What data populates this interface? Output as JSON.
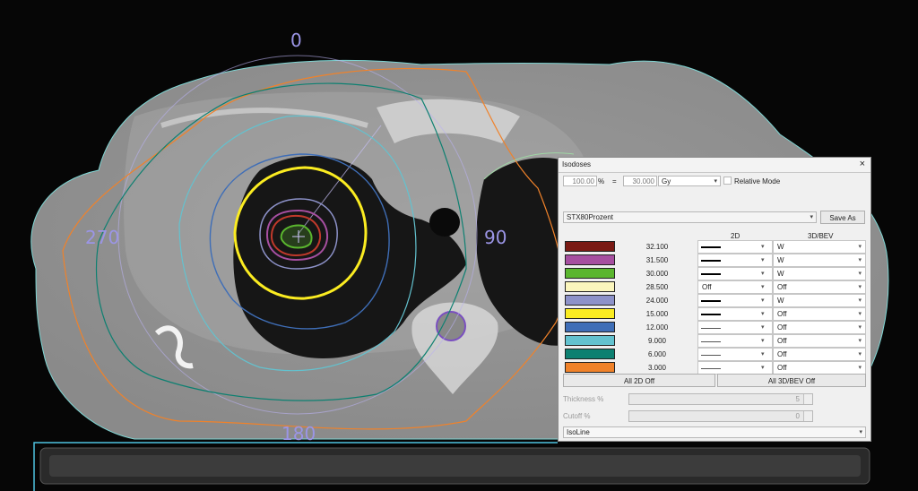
{
  "viewer": {
    "angle_top": "0",
    "angle_right": "90",
    "angle_bottom": "180",
    "angle_left": "270"
  },
  "panel": {
    "title": "Isodoses",
    "close_icon": "close-icon",
    "reference_percent": "100.00",
    "percent_sign": "%",
    "equals": "=",
    "reference_dose": "30.000",
    "unit": "Gy",
    "relative_mode_label": "Relative Mode",
    "relative_mode_checked": false,
    "preset": "STX80Prozent",
    "save_as_label": "Save As",
    "col_2d": "2D",
    "col_3d": "3D/BEV",
    "levels": [
      {
        "dose": "32.100",
        "color": "#7a1a14",
        "d2": "thick",
        "d2_text": "",
        "d3": "W"
      },
      {
        "dose": "31.500",
        "color": "#a64fa0",
        "d2": "thick",
        "d2_text": "",
        "d3": "W"
      },
      {
        "dose": "30.000",
        "color": "#5ab62e",
        "d2": "thick",
        "d2_text": "",
        "d3": "W"
      },
      {
        "dose": "28.500",
        "color": "#fbf6bd",
        "d2": "text",
        "d2_text": "Off",
        "d3": "Off"
      },
      {
        "dose": "24.000",
        "color": "#8d92c9",
        "d2": "thick",
        "d2_text": "",
        "d3": "W"
      },
      {
        "dose": "15.000",
        "color": "#fbec21",
        "d2": "thick",
        "d2_text": "",
        "d3": "Off"
      },
      {
        "dose": "12.000",
        "color": "#3f6eb7",
        "d2": "thin",
        "d2_text": "",
        "d3": "Off"
      },
      {
        "dose": "9.000",
        "color": "#63c2cf",
        "d2": "thin",
        "d2_text": "",
        "d3": "Off"
      },
      {
        "dose": "6.000",
        "color": "#0d8071",
        "d2": "thin",
        "d2_text": "",
        "d3": "Off"
      },
      {
        "dose": "3.000",
        "color": "#f0822a",
        "d2": "thin",
        "d2_text": "",
        "d3": "Off"
      }
    ],
    "all_2d_off": "All 2D Off",
    "all_3d_off": "All 3D/BEV Off",
    "thickness_label": "Thickness %",
    "thickness_value": "5",
    "cutoff_label": "Cutoff %",
    "cutoff_value": "0",
    "line_style": "IsoLine"
  }
}
